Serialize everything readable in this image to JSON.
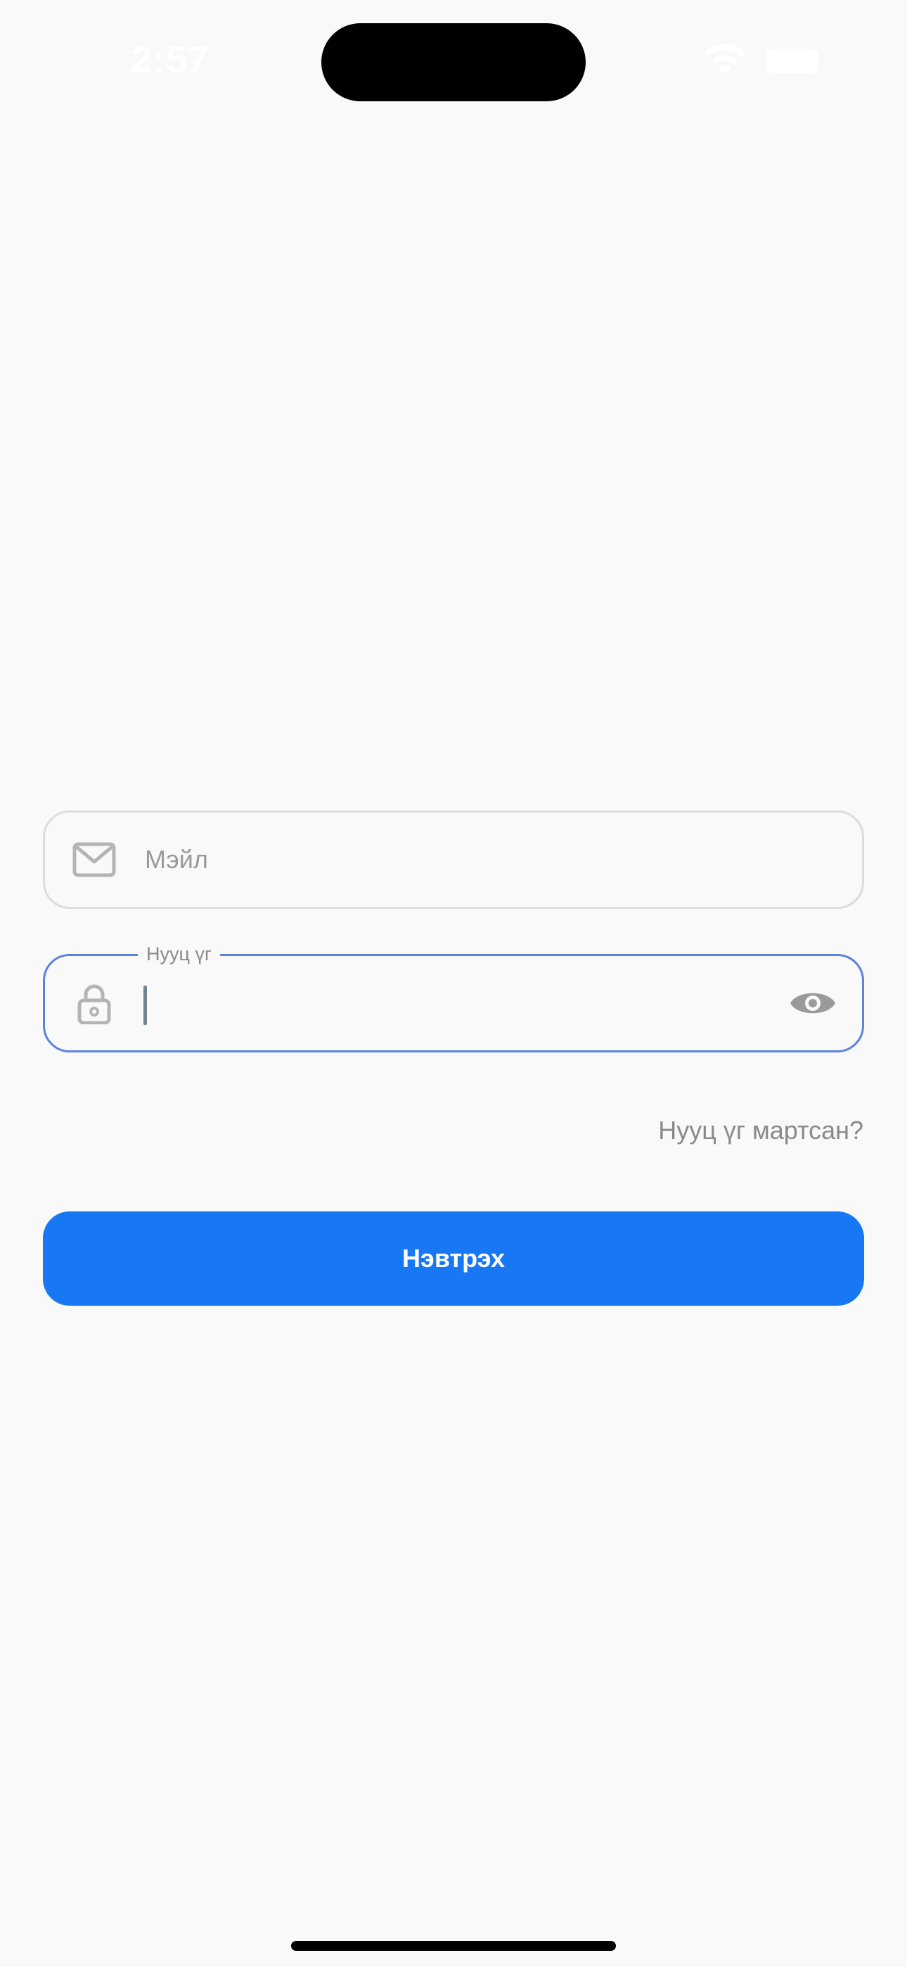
{
  "status_bar": {
    "time": "2:57",
    "wifi_icon": "wifi-icon",
    "battery_icon": "battery-icon"
  },
  "login_form": {
    "email": {
      "icon": "mail-icon",
      "placeholder": "Мэйл",
      "value": ""
    },
    "password": {
      "icon": "lock-icon",
      "label": "Нууц үг",
      "value": "",
      "toggle_icon": "eye-icon",
      "focused": true
    },
    "forgot_password_label": "Нууц үг мартсан?",
    "submit_label": "Нэвтрэх"
  },
  "colors": {
    "background": "#f9f9f9",
    "accent": "#1877f2",
    "focus_border": "#5b82e0",
    "idle_border": "#dcdcdc",
    "muted_text": "#8a8a8a"
  }
}
